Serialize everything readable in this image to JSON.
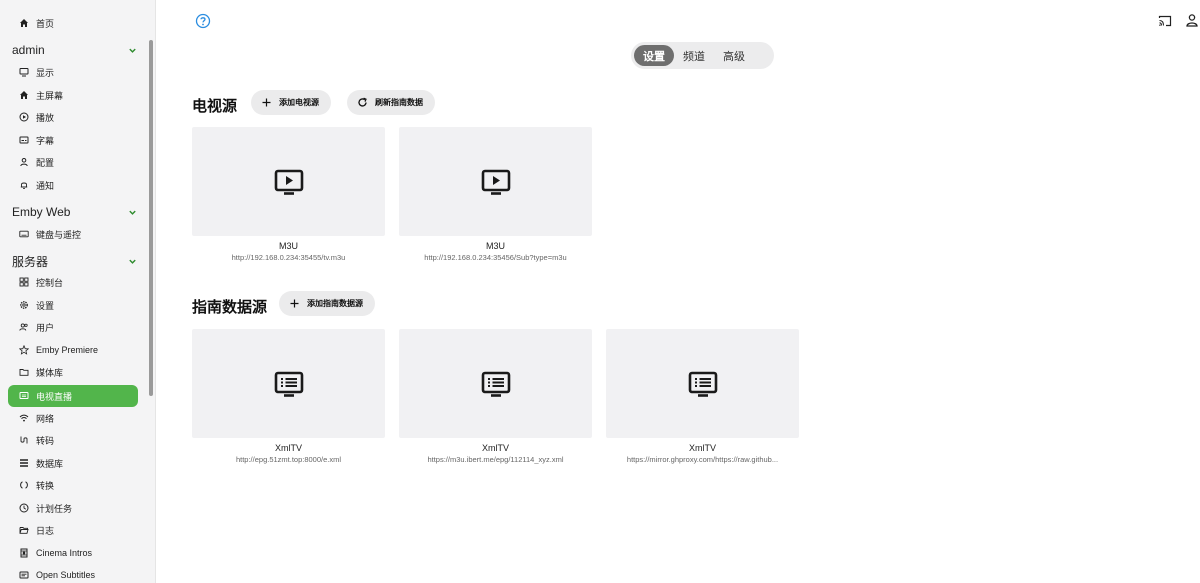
{
  "sidebar": {
    "home": "首页",
    "admin_header": "admin",
    "admin_items": [
      "显示",
      "主屏幕",
      "播放",
      "字幕",
      "配置",
      "通知"
    ],
    "embyweb_header": "Emby Web",
    "embyweb_items": [
      "键盘与遥控"
    ],
    "server_header": "服务器",
    "server_items": [
      "控制台",
      "设置",
      "用户",
      "Emby Premiere",
      "媒体库",
      "电视直播",
      "网络",
      "转码",
      "数据库",
      "转换",
      "计划任务",
      "日志",
      "Cinema Intros",
      "Open Subtitles"
    ],
    "active_item": "电视直播",
    "accent_color": "#52b54b"
  },
  "tabs": [
    "设置",
    "频道",
    "高级"
  ],
  "tv_sources": {
    "title": "电视源",
    "add_button": "添加电视源",
    "refresh_button": "刷新指南数据",
    "items": [
      {
        "name": "M3U",
        "url": "http://192.168.0.234:35455/tv.m3u"
      },
      {
        "name": "M3U",
        "url": "http://192.168.0.234:35456/Sub?type=m3u"
      }
    ]
  },
  "guide_sources": {
    "title": "指南数据源",
    "add_button": "添加指南数据源",
    "items": [
      {
        "name": "XmlTV",
        "url": "http://epg.51zmt.top:8000/e.xml"
      },
      {
        "name": "XmlTV",
        "url": "https://m3u.ibert.me/epg/112114_xyz.xml"
      },
      {
        "name": "XmlTV",
        "url": "https://mirror.ghproxy.com/https://raw.github..."
      }
    ]
  }
}
